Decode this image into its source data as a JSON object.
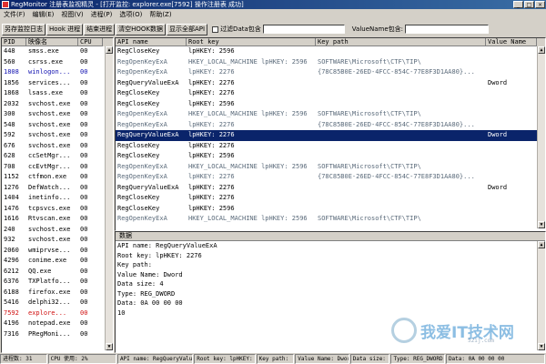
{
  "titlebar": {
    "title": "RegMonitor 注册表监视精灵 - [打开监控: explorer.exe[7592] 操作注册表 成功]",
    "min": "_",
    "max": "□",
    "close": "×"
  },
  "menu": [
    "文件(F)",
    "编辑(E)",
    "视图(V)",
    "进程(P)",
    "选项(O)",
    "帮助(Z)"
  ],
  "toolbar": {
    "save_log": "另存监控日志",
    "hook_process": "Hook 进程",
    "end_process": "结束进程",
    "clear_hook": "清空HOOK数据",
    "show_all_api": "显示全部API",
    "filter_label": "过滤Data包含",
    "valuename_label": "ValueName包含:"
  },
  "process_table": {
    "headers": [
      "PID",
      "映像名",
      "CPU"
    ],
    "rows": [
      {
        "pid": "448",
        "name": "smss.exe",
        "cpu": "00",
        "color": "black"
      },
      {
        "pid": "560",
        "name": "csrss.exe",
        "cpu": "00",
        "color": "black"
      },
      {
        "pid": "1808",
        "name": "winlogon...",
        "cpu": "00",
        "color": "blue"
      },
      {
        "pid": "1856",
        "name": "services...",
        "cpu": "00",
        "color": "black"
      },
      {
        "pid": "1868",
        "name": "lsass.exe",
        "cpu": "00",
        "color": "black"
      },
      {
        "pid": "2032",
        "name": "svchost.exe",
        "cpu": "00",
        "color": "black"
      },
      {
        "pid": "300",
        "name": "svchost.exe",
        "cpu": "00",
        "color": "black"
      },
      {
        "pid": "548",
        "name": "svchost.exe",
        "cpu": "00",
        "color": "black"
      },
      {
        "pid": "592",
        "name": "svchost.exe",
        "cpu": "00",
        "color": "black"
      },
      {
        "pid": "676",
        "name": "svchost.exe",
        "cpu": "00",
        "color": "black"
      },
      {
        "pid": "628",
        "name": "ccSetMgr...",
        "cpu": "00",
        "color": "black"
      },
      {
        "pid": "708",
        "name": "ccEvtMgr...",
        "cpu": "00",
        "color": "black"
      },
      {
        "pid": "1152",
        "name": "ctfmon.exe",
        "cpu": "00",
        "color": "black"
      },
      {
        "pid": "1276",
        "name": "DefWatch...",
        "cpu": "00",
        "color": "black"
      },
      {
        "pid": "1404",
        "name": "inetinfo...",
        "cpu": "00",
        "color": "black"
      },
      {
        "pid": "1476",
        "name": "tcpsvcs.exe",
        "cpu": "00",
        "color": "black"
      },
      {
        "pid": "1616",
        "name": "Rtvscan.exe",
        "cpu": "00",
        "color": "black"
      },
      {
        "pid": "240",
        "name": "svchost.exe",
        "cpu": "00",
        "color": "black"
      },
      {
        "pid": "932",
        "name": "svchost.exe",
        "cpu": "00",
        "color": "black"
      },
      {
        "pid": "2060",
        "name": "wmiprvse...",
        "cpu": "00",
        "color": "black"
      },
      {
        "pid": "4296",
        "name": "conime.exe",
        "cpu": "00",
        "color": "black"
      },
      {
        "pid": "6212",
        "name": "QQ.exe",
        "cpu": "00",
        "color": "black"
      },
      {
        "pid": "6376",
        "name": "TXPlatfo...",
        "cpu": "00",
        "color": "black"
      },
      {
        "pid": "6188",
        "name": "firefox.exe",
        "cpu": "00",
        "color": "black"
      },
      {
        "pid": "5416",
        "name": "delphi32...",
        "cpu": "00",
        "color": "black"
      },
      {
        "pid": "7592",
        "name": "explore...",
        "cpu": "00",
        "color": "red"
      },
      {
        "pid": "4196",
        "name": "notepad.exe",
        "cpu": "00",
        "color": "black"
      },
      {
        "pid": "7316",
        "name": "PRegMoni...",
        "cpu": "00",
        "color": "black"
      }
    ]
  },
  "api_table": {
    "headers": [
      "API name",
      "Root key",
      "Key path",
      "Value Name"
    ],
    "rows": [
      {
        "api": "RegCloseKey",
        "root": "lpHKEY: 2596",
        "path": "",
        "value": "",
        "style": "black"
      },
      {
        "api": "RegOpenKeyExA",
        "root": "HKEY_LOCAL_MACHINE lpHKEY: 2596",
        "path": "SOFTWARE\\Microsoft\\CTF\\TIP\\",
        "value": "",
        "style": "gray"
      },
      {
        "api": "RegOpenKeyExA",
        "root": "lpHKEY: 2276",
        "path": "{78C85B0E-26ED-4FCC-854C-77E8F3D1AA80}...",
        "value": "",
        "style": "gray"
      },
      {
        "api": "RegQueryValueExA",
        "root": "lpHKEY: 2276",
        "path": "",
        "value": "Dword",
        "style": "black"
      },
      {
        "api": "RegCloseKey",
        "root": "lpHKEY: 2276",
        "path": "",
        "value": "",
        "style": "black"
      },
      {
        "api": "RegCloseKey",
        "root": "lpHKEY: 2596",
        "path": "",
        "value": "",
        "style": "black"
      },
      {
        "api": "RegOpenKeyExA",
        "root": "HKEY_LOCAL_MACHINE lpHKEY: 2596",
        "path": "SOFTWARE\\Microsoft\\CTF\\TIP\\",
        "value": "",
        "style": "gray"
      },
      {
        "api": "RegOpenKeyExA",
        "root": "lpHKEY: 2276",
        "path": "{78C85B0E-26ED-4FCC-854C-77E8F3D1AA80}...",
        "value": "",
        "style": "gray"
      },
      {
        "api": "RegQueryValueExA",
        "root": "lpHKEY: 2276",
        "path": "",
        "value": "Dword",
        "style": "selected"
      },
      {
        "api": "RegCloseKey",
        "root": "lpHKEY: 2276",
        "path": "",
        "value": "",
        "style": "black"
      },
      {
        "api": "RegCloseKey",
        "root": "lpHKEY: 2596",
        "path": "",
        "value": "",
        "style": "black"
      },
      {
        "api": "RegOpenKeyExA",
        "root": "HKEY_LOCAL_MACHINE lpHKEY: 2596",
        "path": "SOFTWARE\\Microsoft\\CTF\\TIP\\",
        "value": "",
        "style": "gray"
      },
      {
        "api": "RegOpenKeyExA",
        "root": "lpHKEY: 2276",
        "path": "{78C85B0E-26ED-4FCC-854C-77E8F3D1AA80}...",
        "value": "",
        "style": "gray"
      },
      {
        "api": "RegQueryValueExA",
        "root": "lpHKEY: 2276",
        "path": "",
        "value": "Dword",
        "style": "black"
      },
      {
        "api": "RegCloseKey",
        "root": "lpHKEY: 2276",
        "path": "",
        "value": "",
        "style": "black"
      },
      {
        "api": "RegCloseKey",
        "root": "lpHKEY: 2596",
        "path": "",
        "value": "",
        "style": "black"
      },
      {
        "api": "RegOpenKeyExA",
        "root": "HKEY_LOCAL_MACHINE lpHKEY: 2596",
        "path": "SOFTWARE\\Microsoft\\CTF\\TIP\\",
        "value": "",
        "style": "gray"
      }
    ]
  },
  "data_panel": {
    "title": "数据",
    "lines": [
      "API name: RegQueryValueExA",
      "Root key: lpHKEY: 2276",
      "Key path:",
      "Value Name: Dword",
      "Data size: 4",
      "Type: REG_DWORD",
      "Data: 0A 00 00 00",
      "10"
    ]
  },
  "statusbar": {
    "parts": [
      "进程数: 31",
      "CPU 使用: 2%",
      "API name: RegQueryValueExA",
      "Root key: lpHKEY: 2276",
      "Key path:",
      "Value Name: Dword",
      "Data size: 4",
      "Type: REG_DWORD",
      "Data: 0A 00 00 00"
    ]
  },
  "watermark": {
    "text": "我爱IT技术网",
    "url": "52ij.com"
  },
  "colors": {
    "selected_row": "#0a246a",
    "highlight_pid": "#d01010",
    "blue_text": "#1010b0",
    "gray_text": "#5a6a7a",
    "window_face": "#d4d0c8"
  }
}
